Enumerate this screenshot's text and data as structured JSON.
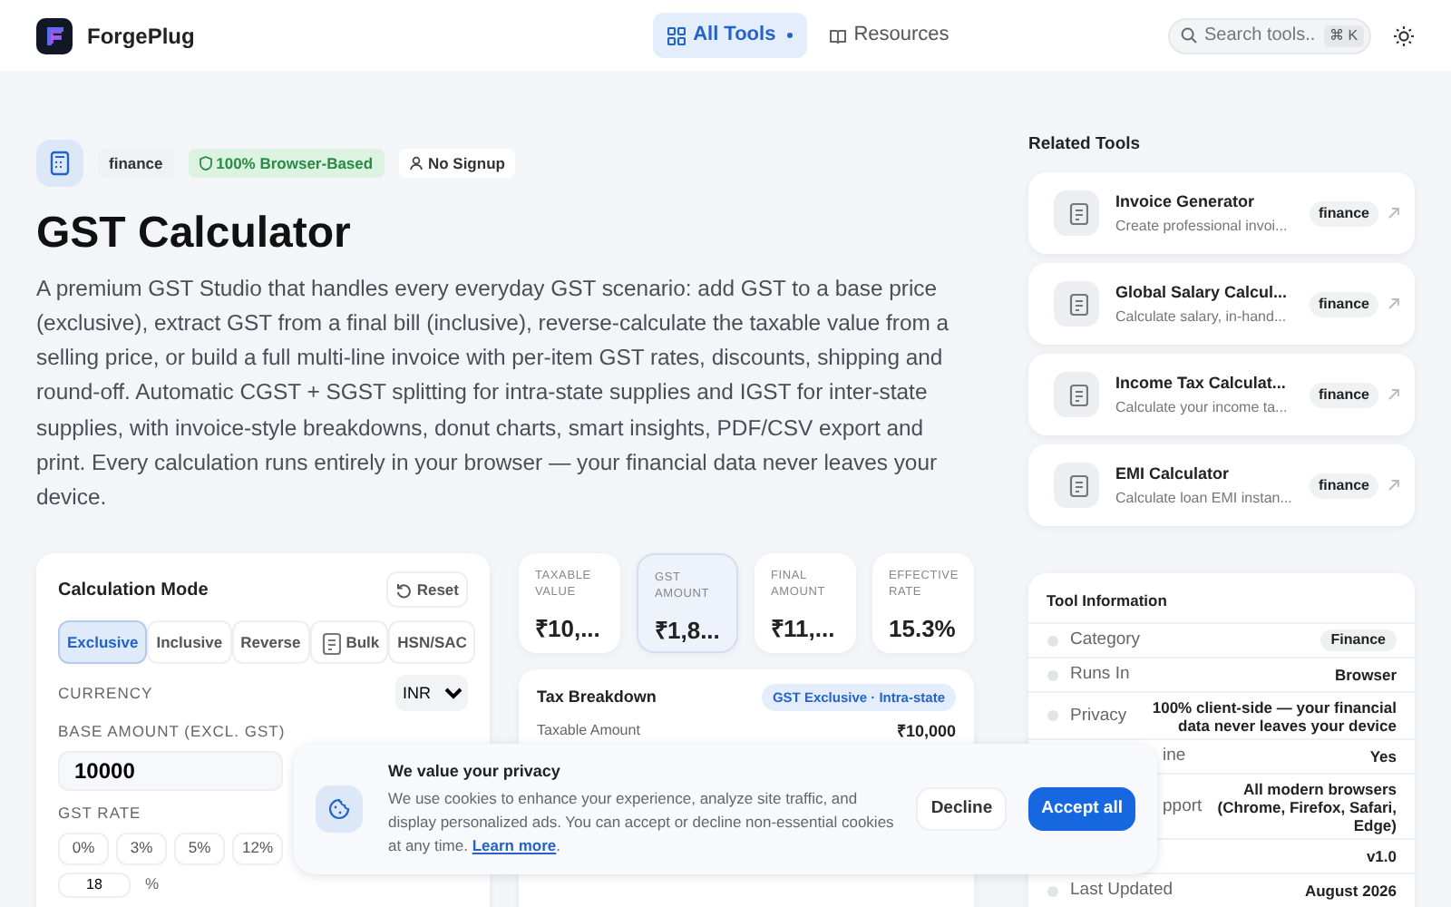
{
  "header": {
    "brand": "ForgePlug",
    "nav": [
      {
        "label": "All Tools",
        "selected": true
      },
      {
        "label": "Resources",
        "selected": false
      }
    ],
    "search": {
      "placeholder": "Search tools...",
      "shortcut": "⌘ K"
    }
  },
  "tool": {
    "badges": [
      {
        "label": "finance",
        "kind": "plain"
      },
      {
        "label": "100% Browser-Based",
        "kind": "green"
      },
      {
        "label": "No Signup",
        "kind": "user"
      }
    ],
    "title": "GST Calculator",
    "description": "A premium GST Studio that handles every everyday GST scenario: add GST to a base price (exclusive), extract GST from a final bill (inclusive), reverse-calculate the taxable value from a selling price, or build a full multi-line invoice with per-item GST rates, discounts, shipping and round-off. Automatic CGST + SGST splitting for intra-state supplies and IGST for inter-state supplies, with invoice-style breakdowns, donut charts, smart insights, PDF/CSV export and print. Every calculation runs entirely in your browser — your financial data never leaves your device."
  },
  "calculator": {
    "title": "Calculation Mode",
    "reset": "Reset",
    "modes": [
      {
        "label": "Exclusive",
        "selected": true
      },
      {
        "label": "Inclusive",
        "selected": false
      },
      {
        "label": "Reverse",
        "selected": false
      },
      {
        "label": "Bulk",
        "selected": false
      },
      {
        "label": "HSN/SAC",
        "selected": false
      }
    ],
    "currency_label": "CURRENCY",
    "currency": "INR",
    "amount_label": "BASE AMOUNT (EXCL. GST)",
    "amount": "10000",
    "rate_label": "GST RATE",
    "rates": [
      {
        "label": "0%",
        "selected": false
      },
      {
        "label": "3%",
        "selected": false
      },
      {
        "label": "5%",
        "selected": false
      },
      {
        "label": "12%",
        "selected": false
      }
    ],
    "custom_rate": "18",
    "custom_unit": "%"
  },
  "stats": [
    {
      "label": "TAXABLE VALUE",
      "value": "₹10,...",
      "selected": false
    },
    {
      "label": "GST AMOUNT",
      "value": "₹1,8...",
      "selected": true
    },
    {
      "label": "FINAL AMOUNT",
      "value": "₹11,...",
      "selected": false
    },
    {
      "label": "EFFECTIVE RATE",
      "value": "15.3%",
      "selected": false
    }
  ],
  "breakdown": {
    "title": "Tax Breakdown",
    "tag": "GST Exclusive · Intra-state",
    "rows": [
      {
        "label": "Taxable Amount",
        "value": "₹10,000"
      }
    ]
  },
  "related": {
    "title": "Related Tools",
    "items": [
      {
        "name": "Invoice Generator",
        "desc": "Create professional invoi...",
        "tag": "finance"
      },
      {
        "name": "Global Salary Calcul...",
        "desc": "Calculate salary, in-hand...",
        "tag": "finance"
      },
      {
        "name": "Income Tax Calculat...",
        "desc": "Calculate your income ta...",
        "tag": "finance"
      },
      {
        "name": "EMI Calculator",
        "desc": "Calculate loan EMI instan...",
        "tag": "finance"
      }
    ]
  },
  "info": {
    "title": "Tool Information",
    "rows": [
      {
        "label": "Category",
        "value": "Finance",
        "kind": "tag"
      },
      {
        "label": "Runs In",
        "value": "Browser",
        "kind": "text"
      },
      {
        "label": "Privacy",
        "value": "100% client-side — your financial data never leaves your device",
        "kind": "text"
      },
      {
        "label": "ine",
        "value": "Yes",
        "kind": "covered"
      },
      {
        "label": "pport",
        "value": "All modern browsers (Chrome, Firefox, Safari, Edge)",
        "kind": "covered"
      },
      {
        "value": "v1.0",
        "kind": "covered"
      },
      {
        "label": "Last Updated",
        "value": "August 2026",
        "kind": "text"
      }
    ]
  },
  "cookie": {
    "title": "We value your privacy",
    "text": "We use cookies to enhance your experience, analyze site traffic, and display personalized ads. You can accept or decline non-essential cookies at any time.",
    "link": "Learn more",
    "after_link": ".",
    "decline": "Decline",
    "accept": "Accept all"
  }
}
